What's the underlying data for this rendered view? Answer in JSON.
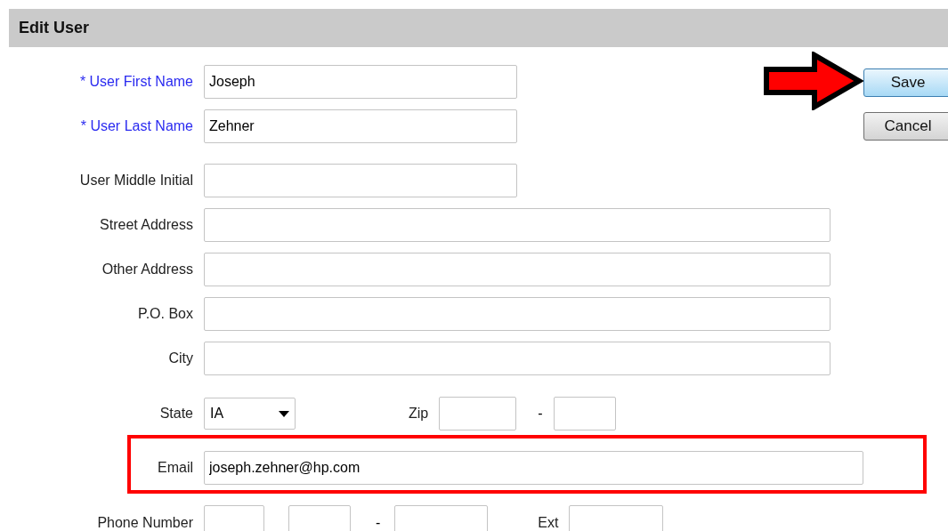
{
  "title": "Edit User",
  "buttons": [
    {
      "label": "Save",
      "focused": true,
      "annotated": true
    },
    {
      "label": "Cancel",
      "focused": false,
      "annotated": false
    }
  ],
  "name_fields": [
    {
      "label": "* User First Name",
      "required": true,
      "value": "Joseph"
    },
    {
      "label": "* User Last Name",
      "required": true,
      "value": "Zehner"
    },
    {
      "label": "User Middle Initial",
      "required": false
    }
  ],
  "address_fields": [
    {
      "label": "Street Address"
    },
    {
      "label": "Other Address"
    },
    {
      "label": "P.O. Box"
    },
    {
      "label": "City"
    }
  ],
  "state": {
    "label": "State",
    "value": "IA"
  },
  "zip": {
    "label": "Zip",
    "separator": "-"
  },
  "email": {
    "label": "Email",
    "value": "joseph.zehner@hp.com",
    "annotated": true
  },
  "phone": {
    "label": "Phone Number",
    "separator": "-",
    "ext_label": "Ext"
  }
}
